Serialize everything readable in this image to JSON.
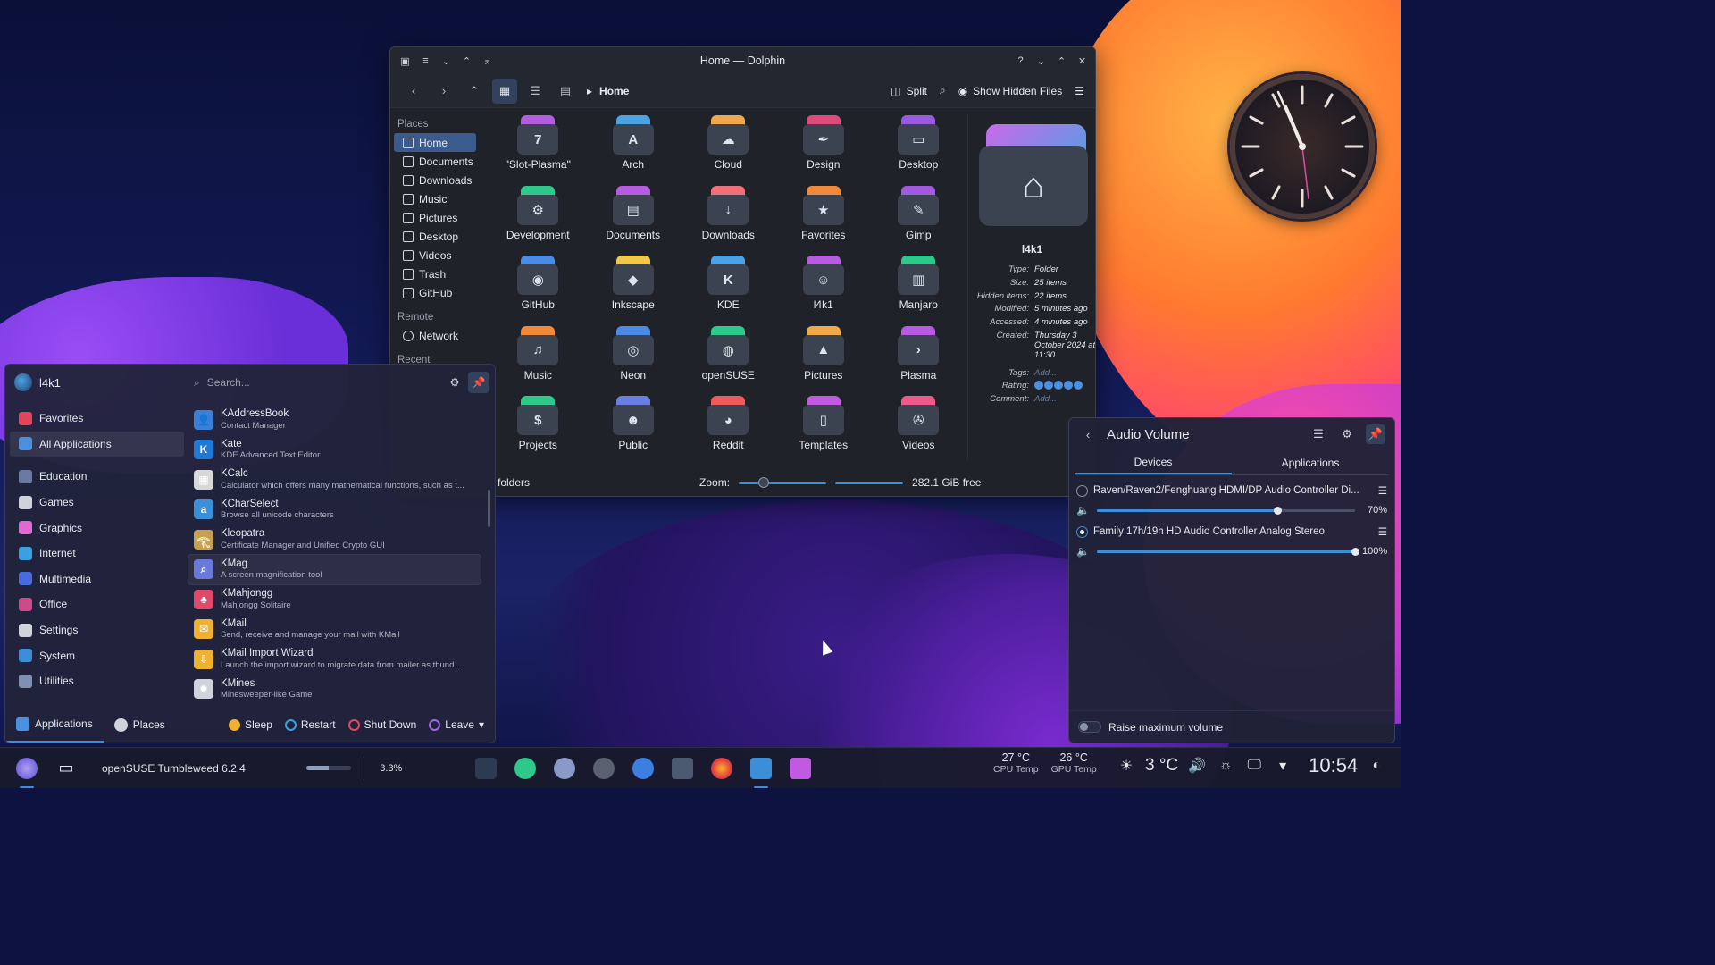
{
  "dolphin": {
    "title": "Home — Dolphin",
    "breadcrumb": "Home",
    "split_label": "Split",
    "show_hidden_label": "Show Hidden Files",
    "places_header": "Places",
    "places": [
      "Home",
      "Documents",
      "Downloads",
      "Music",
      "Pictures",
      "Desktop",
      "Videos",
      "Trash",
      "GitHub"
    ],
    "remote_header": "Remote",
    "remote": [
      "Network"
    ],
    "recent_header": "Recent",
    "folders": [
      {
        "name": "\"Slot-Plasma\"",
        "color": "#b65ce0",
        "glyph": "7"
      },
      {
        "name": "Arch",
        "color": "#4ba3e3",
        "glyph": "A"
      },
      {
        "name": "Cloud",
        "color": "#f0a84a",
        "glyph": "☁"
      },
      {
        "name": "Design",
        "color": "#e04a7a",
        "glyph": "✒"
      },
      {
        "name": "Desktop",
        "color": "#9a5ae0",
        "glyph": "▭"
      },
      {
        "name": "Development",
        "color": "#2ec98a",
        "glyph": "⚙"
      },
      {
        "name": "Documents",
        "color": "#b65ce0",
        "glyph": "▤"
      },
      {
        "name": "Downloads",
        "color": "#ef6f7a",
        "glyph": "↓"
      },
      {
        "name": "Favorites",
        "color": "#f08a3a",
        "glyph": "★"
      },
      {
        "name": "Gimp",
        "color": "#a05ae0",
        "glyph": "✎"
      },
      {
        "name": "GitHub",
        "color": "#4b8be3",
        "glyph": "◉"
      },
      {
        "name": "Inkscape",
        "color": "#f0c84a",
        "glyph": "◆"
      },
      {
        "name": "KDE",
        "color": "#4ba3e3",
        "glyph": "K"
      },
      {
        "name": "l4k1",
        "color": "#b65ce0",
        "glyph": "☺"
      },
      {
        "name": "Manjaro",
        "color": "#2ec98a",
        "glyph": "▥"
      },
      {
        "name": "Music",
        "color": "#f08a3a",
        "glyph": "♫"
      },
      {
        "name": "Neon",
        "color": "#4b8be3",
        "glyph": "◎"
      },
      {
        "name": "openSUSE",
        "color": "#2ec98a",
        "glyph": "◍"
      },
      {
        "name": "Pictures",
        "color": "#f0a84a",
        "glyph": "▲"
      },
      {
        "name": "Plasma",
        "color": "#b65ce0",
        "glyph": "›"
      },
      {
        "name": "Projects",
        "color": "#2ec98a",
        "glyph": "$"
      },
      {
        "name": "Public",
        "color": "#6a7de0",
        "glyph": "☻"
      },
      {
        "name": "Reddit",
        "color": "#ef5a5a",
        "glyph": "◕"
      },
      {
        "name": "Templates",
        "color": "#c05ae0",
        "glyph": "▯"
      },
      {
        "name": "Videos",
        "color": "#ef5a8a",
        "glyph": "✇"
      }
    ],
    "status_left": "folders",
    "zoom_label": "Zoom:",
    "free_space": "282.1 GiB free",
    "info": {
      "name": "l4k1",
      "rows": [
        {
          "k": "Type:",
          "v": "Folder"
        },
        {
          "k": "Size:",
          "v": "25 items"
        },
        {
          "k": "Hidden items:",
          "v": "22 items"
        },
        {
          "k": "Modified:",
          "v": "5 minutes ago"
        },
        {
          "k": "Accessed:",
          "v": "4 minutes ago"
        },
        {
          "k": "Created:",
          "v": "Thursday 3 October 2024 at 11:30"
        }
      ],
      "tags_label": "Tags:",
      "tags_value": "Add...",
      "rating_label": "Rating:",
      "rating": 5,
      "comment_label": "Comment:",
      "comment_value": "Add..."
    }
  },
  "launcher": {
    "user": "l4k1",
    "search_placeholder": "Search...",
    "categories": [
      {
        "label": "Favorites",
        "color": "#e0455a"
      },
      {
        "label": "All Applications",
        "color": "#4a8fe0"
      },
      {
        "label": "Education",
        "color": "#6a7aa0"
      },
      {
        "label": "Games",
        "color": "#cfd3dc"
      },
      {
        "label": "Graphics",
        "color": "#e06ad0"
      },
      {
        "label": "Internet",
        "color": "#3ba0e0"
      },
      {
        "label": "Multimedia",
        "color": "#4a6ae0"
      },
      {
        "label": "Office",
        "color": "#d04a8a"
      },
      {
        "label": "Settings",
        "color": "#cfd3dc"
      },
      {
        "label": "System",
        "color": "#3b8fd8"
      },
      {
        "label": "Utilities",
        "color": "#8090b0"
      }
    ],
    "apps": [
      {
        "name": "KAddressBook",
        "desc": "Contact Manager",
        "color": "#3b7fd8",
        "glyph": "👤"
      },
      {
        "name": "Kate",
        "desc": "KDE Advanced Text Editor",
        "color": "#1f7ad6",
        "glyph": "K"
      },
      {
        "name": "KCalc",
        "desc": "Calculator which offers many mathematical functions, such as t...",
        "color": "#d8d8d8",
        "glyph": "▦"
      },
      {
        "name": "KCharSelect",
        "desc": "Browse all unicode characters",
        "color": "#3b8fd8",
        "glyph": "a"
      },
      {
        "name": "Kleopatra",
        "desc": "Certificate Manager and Unified Crypto GUI",
        "color": "#c8a050",
        "glyph": "𓂀"
      },
      {
        "name": "KMag",
        "desc": "A screen magnification tool",
        "color": "#6a7ad8",
        "glyph": "⌕"
      },
      {
        "name": "KMahjongg",
        "desc": "Mahjongg Solitaire",
        "color": "#e04a6a",
        "glyph": "♣"
      },
      {
        "name": "KMail",
        "desc": "Send, receive and manage your mail with KMail",
        "color": "#f0b030",
        "glyph": "✉"
      },
      {
        "name": "KMail Import Wizard",
        "desc": "Launch the import wizard to migrate data from mailer as thund...",
        "color": "#f0b030",
        "glyph": "⇩"
      },
      {
        "name": "KMines",
        "desc": "Minesweeper-like Game",
        "color": "#cfd3dc",
        "glyph": "✹"
      }
    ],
    "tab_applications": "Applications",
    "tab_places": "Places",
    "sleep": "Sleep",
    "restart": "Restart",
    "shutdown": "Shut Down",
    "leave": "Leave"
  },
  "audio": {
    "title": "Audio Volume",
    "tab_devices": "Devices",
    "tab_applications": "Applications",
    "devices": [
      {
        "name": "Raven/Raven2/Fenghuang HDMI/DP Audio Controller Di...",
        "volume": 70,
        "volume_label": "70%",
        "default": false
      },
      {
        "name": "Family 17h/19h HD Audio Controller Analog Stereo",
        "volume": 100,
        "volume_label": "100%",
        "default": true
      }
    ],
    "raise_max": "Raise maximum volume"
  },
  "taskbar": {
    "window_title": "openSUSE Tumbleweed 6.2.4",
    "progress": 0.5,
    "cpu": "3.3%",
    "cpu_temp": "27 °C",
    "cpu_temp_label": "CPU Temp",
    "gpu_temp": "26 °C",
    "gpu_temp_label": "GPU Temp",
    "weather": "3 °C",
    "time": "10:54"
  }
}
